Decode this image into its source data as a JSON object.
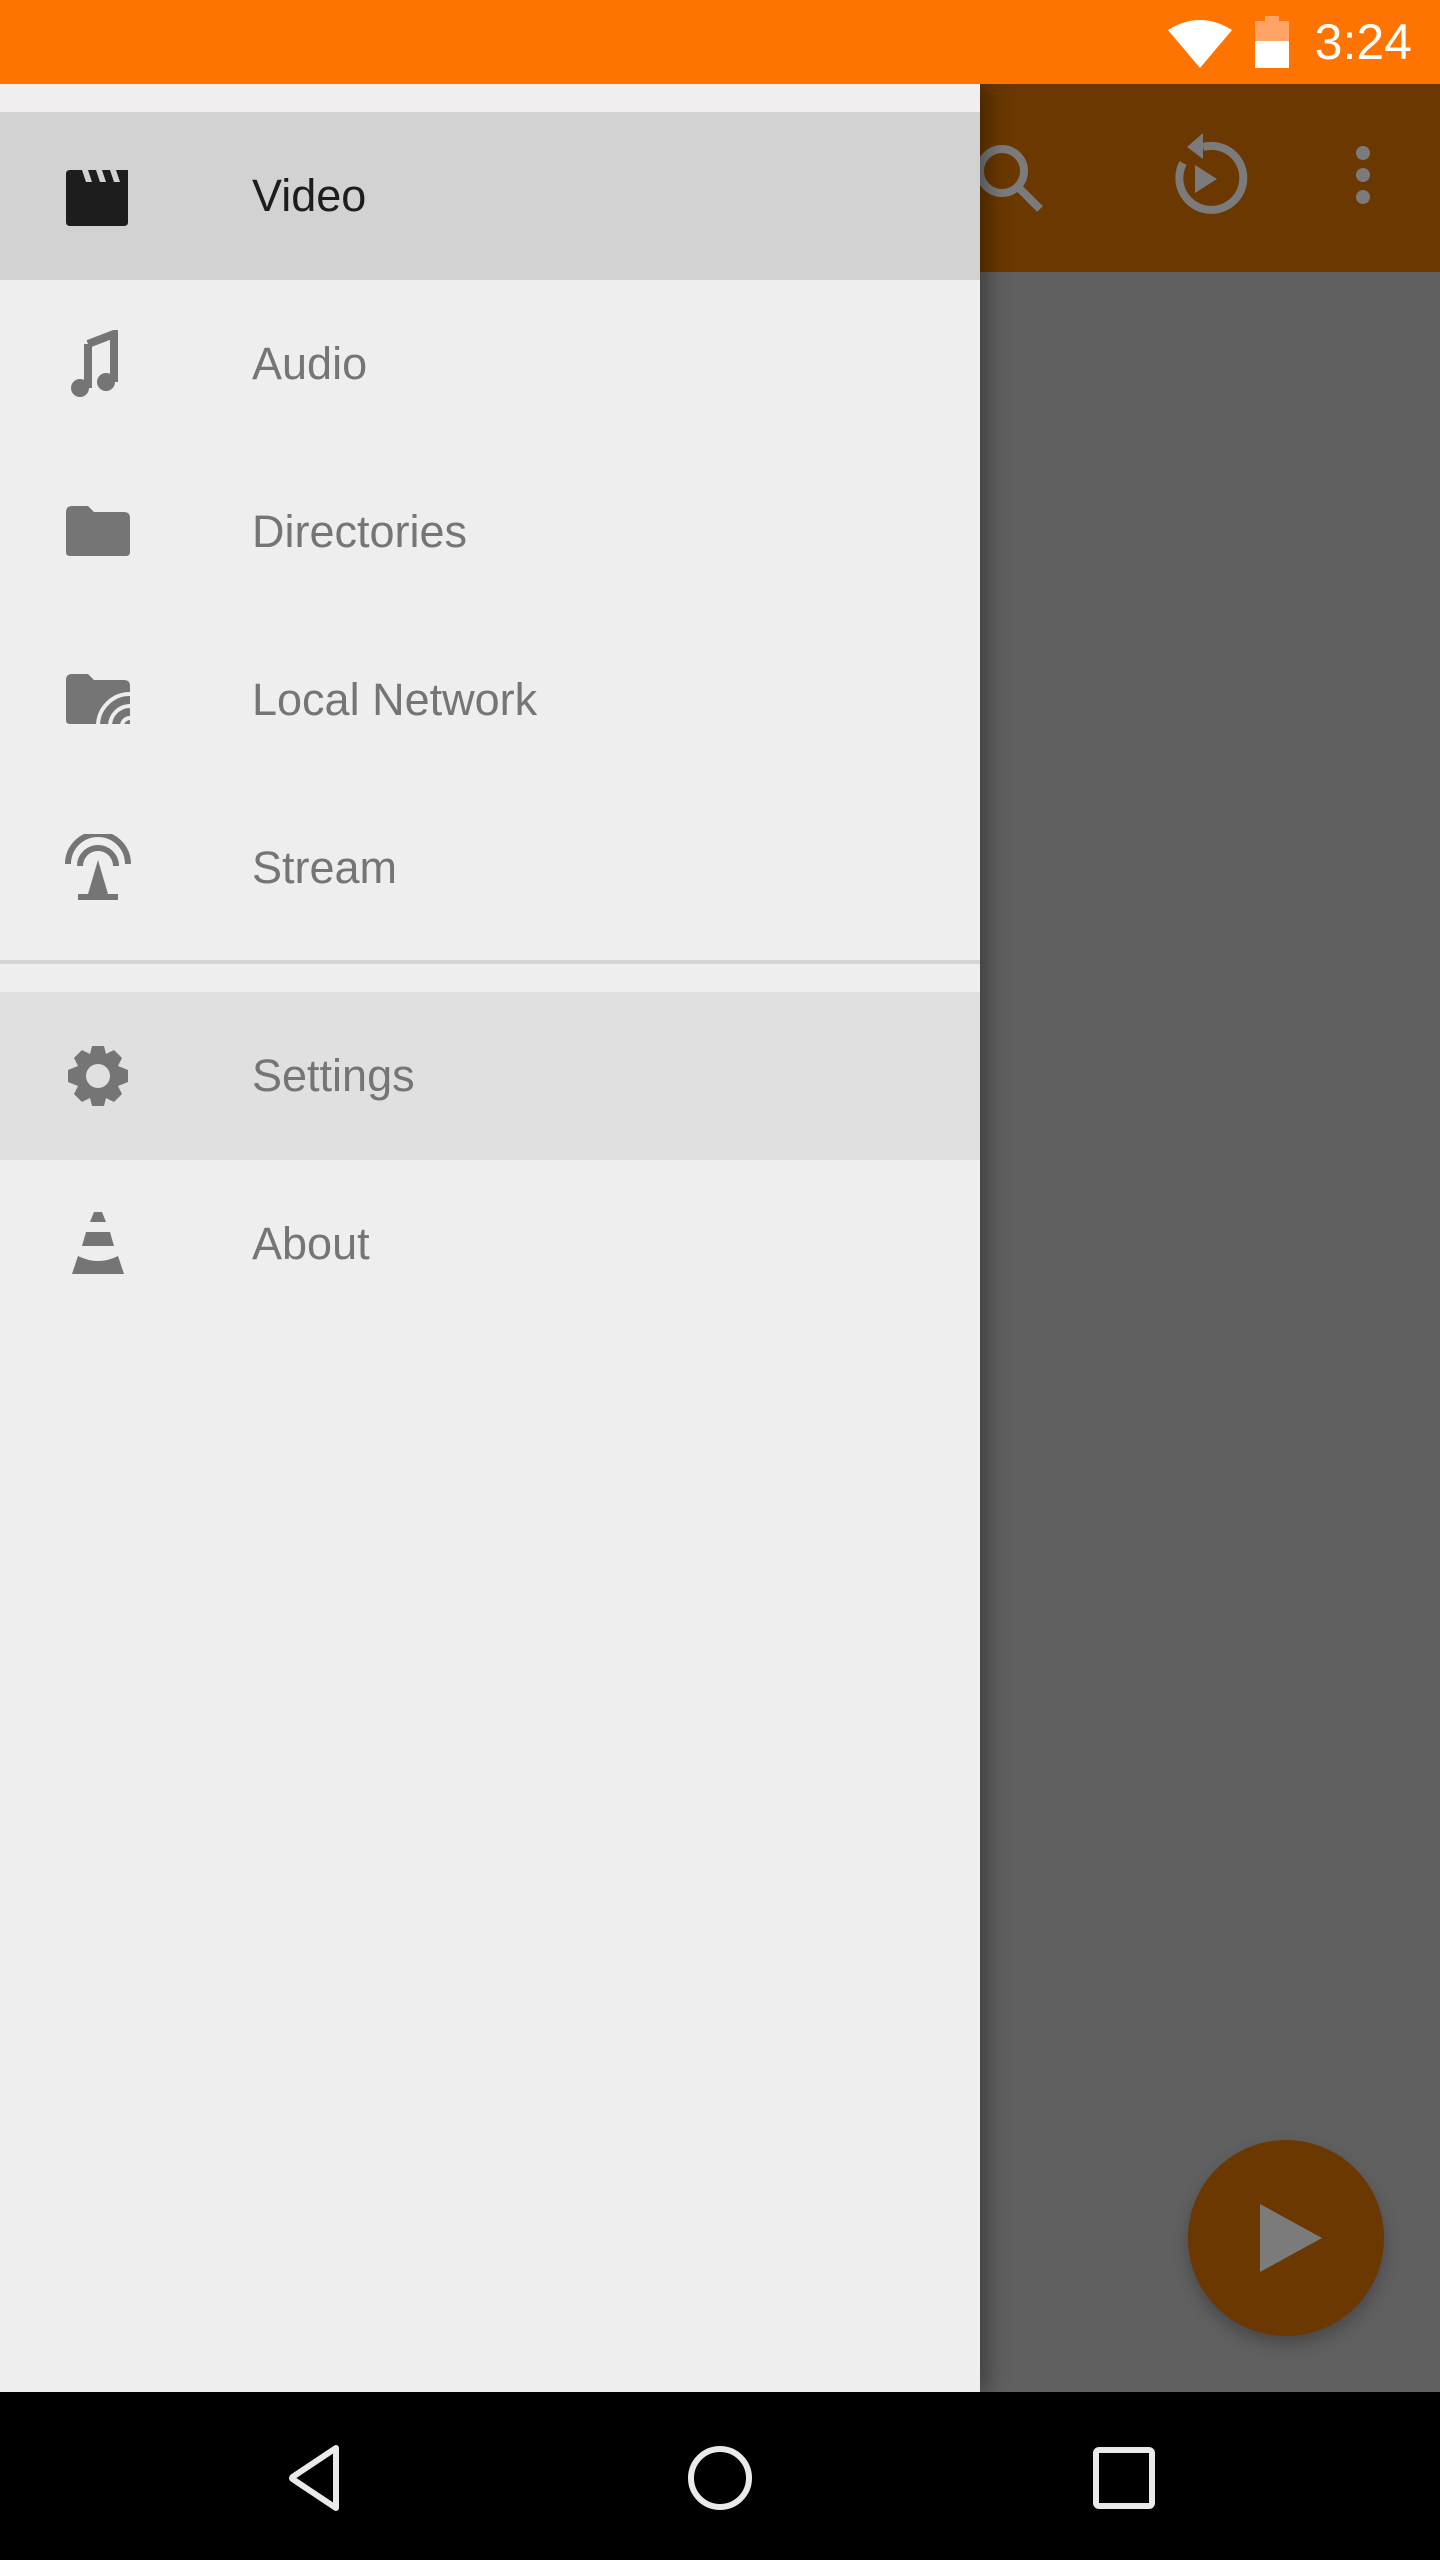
{
  "status_bar": {
    "time": "3:24",
    "wifi_icon": "wifi-icon",
    "battery_icon": "battery-half-icon",
    "color": "#ff7300"
  },
  "app_bar": {
    "color": "#6a3800",
    "actions": [
      {
        "icon": "search-icon",
        "label": "Search"
      },
      {
        "icon": "resume-playback-icon",
        "label": "Resume playback"
      },
      {
        "icon": "more-vert-icon",
        "label": "More options"
      }
    ]
  },
  "drawer": {
    "items": [
      {
        "label": "Video",
        "icon": "video-clapperboard-icon",
        "selected": true
      },
      {
        "label": "Audio",
        "icon": "music-note-icon"
      },
      {
        "label": "Directories",
        "icon": "folder-icon"
      },
      {
        "label": "Local Network",
        "icon": "network-folder-icon"
      },
      {
        "label": "Stream",
        "icon": "stream-antenna-icon"
      }
    ],
    "secondary_items": [
      {
        "label": "Settings",
        "icon": "gear-icon",
        "pressed": true
      },
      {
        "label": "About",
        "icon": "vlc-cone-icon"
      }
    ]
  },
  "fab": {
    "icon": "play-icon",
    "label": "Play"
  },
  "nav_bar": {
    "back": "back-icon",
    "home": "home-icon",
    "recents": "recents-icon"
  }
}
